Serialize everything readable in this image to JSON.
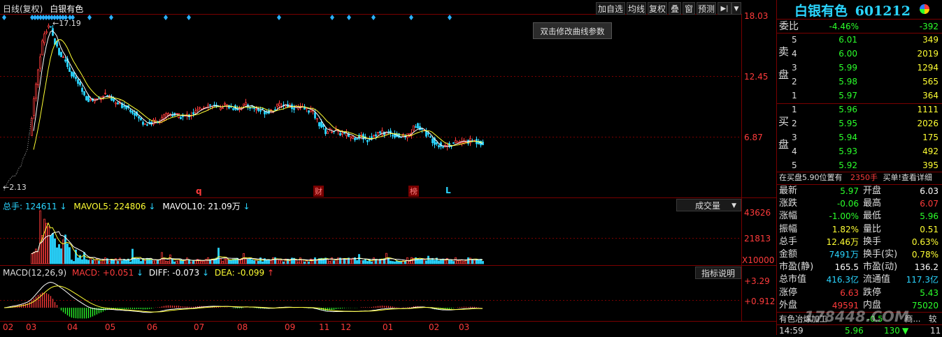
{
  "main_header": {
    "period": "日线(复权)",
    "name": "白银有色"
  },
  "toolbar": [
    "加自选",
    "均线",
    "复权",
    "叠",
    "窗",
    "预测"
  ],
  "toolbar_arrows": {
    "play": "▶|",
    "menu": "▼"
  },
  "tooltip": "双击修改曲线参数",
  "price_axis": {
    "top": "18.03",
    "mid": "12.45",
    "low": "6.87"
  },
  "price_marks": {
    "high": "17.19",
    "low": "2.13"
  },
  "event_labels": [
    {
      "text": "q",
      "boxed": false
    },
    {
      "text": "财",
      "boxed": true
    },
    {
      "text": "榜",
      "boxed": true
    },
    {
      "text": "L",
      "boxed": false
    }
  ],
  "volume_header": {
    "total": "总手: 124611",
    "mavol5": "MAVOL5: 224806",
    "mavol10": "MAVOL10: 21.09万",
    "dropdown": "成交量"
  },
  "volume_axis": {
    "top": "43626",
    "mid": "21813",
    "unit": "X10000"
  },
  "macd_header": {
    "title": "MACD(12,26,9)",
    "macd": "MACD: +0.051",
    "diff": "DIFF: -0.073",
    "dea": "DEA: -0.099",
    "help": "指标说明"
  },
  "macd_axis": {
    "top": "+3.29",
    "mid": "+0.912"
  },
  "x_axis": [
    "02",
    "03",
    "04",
    "05",
    "06",
    "07",
    "08",
    "09",
    "11",
    "12",
    "01",
    "02",
    "03"
  ],
  "quote": {
    "name": "白银有色",
    "code": "601212",
    "weibi_label": "委比",
    "weibi_pct": "-4.46%",
    "weibi_val": "-392",
    "sell_label": [
      "卖",
      "盘"
    ],
    "sell": [
      {
        "lvl": "5",
        "price": "6.01",
        "vol": "349"
      },
      {
        "lvl": "4",
        "price": "6.00",
        "vol": "2019"
      },
      {
        "lvl": "3",
        "price": "5.99",
        "vol": "1294"
      },
      {
        "lvl": "2",
        "price": "5.98",
        "vol": "565"
      },
      {
        "lvl": "1",
        "price": "5.97",
        "vol": "364"
      }
    ],
    "buy_label": [
      "买",
      "盘"
    ],
    "buy": [
      {
        "lvl": "1",
        "price": "5.96",
        "vol": "1111"
      },
      {
        "lvl": "2",
        "price": "5.95",
        "vol": "2026"
      },
      {
        "lvl": "3",
        "price": "5.94",
        "vol": "175"
      },
      {
        "lvl": "4",
        "price": "5.93",
        "vol": "492"
      },
      {
        "lvl": "5",
        "price": "5.92",
        "vol": "395"
      }
    ],
    "notice": {
      "a": "在买盘5.90位置有",
      "b": "2350手",
      "c": "买单!查看详细"
    },
    "stats": [
      {
        "l1": "最新",
        "v1": "5.97",
        "c1": "green",
        "l2": "开盘",
        "v2": "6.03",
        "c2": "white"
      },
      {
        "l1": "涨跌",
        "v1": "-0.06",
        "c1": "green",
        "l2": "最高",
        "v2": "6.07",
        "c2": "red"
      },
      {
        "l1": "涨幅",
        "v1": "-1.00%",
        "c1": "green",
        "l2": "最低",
        "v2": "5.96",
        "c2": "green"
      },
      {
        "l1": "振幅",
        "v1": "1.82%",
        "c1": "yellow",
        "l2": "量比",
        "v2": "0.51",
        "c2": "yellow"
      },
      {
        "l1": "总手",
        "v1": "12.46万",
        "c1": "yellow",
        "l2": "换手",
        "v2": "0.63%",
        "c2": "yellow"
      },
      {
        "l1": "金额",
        "v1": "7491万",
        "c1": "cyan",
        "l2": "换手(实)",
        "v2": "0.78%",
        "c2": "yellow"
      },
      {
        "l1": "市盈(静)",
        "v1": "165.5",
        "c1": "white",
        "l2": "市盈(动)",
        "v2": "136.2",
        "c2": "white"
      },
      {
        "l1": "总市值",
        "v1": "416.3亿",
        "c1": "cyan",
        "l2": "流通值",
        "v2": "117.3亿",
        "c2": "cyan"
      },
      {
        "l1": "涨停",
        "v1": "6.63",
        "c1": "red",
        "l2": "跌停",
        "v2": "5.43",
        "c2": "green"
      },
      {
        "l1": "外盘",
        "v1": "49591",
        "c1": "red",
        "l2": "内盘",
        "v2": "75020",
        "c2": "green"
      }
    ],
    "industry": {
      "name": "有色冶炼加工",
      "pct": "-0.5",
      "extra": "商...",
      "rank": "较"
    },
    "tick": {
      "time": "14:59",
      "price": "5.96",
      "vol": "130",
      "arrow": "▼",
      "num": "11"
    }
  },
  "watermark": "178448.COM",
  "colors": {
    "up": "#ff3b3b",
    "down": "#2ad5ff",
    "ma": "#ffffff",
    "grid": "#7a0000",
    "accent": "#2ad5ff"
  },
  "chart_data": {
    "type": "line",
    "title": "白银有色 日线(复权)",
    "price_ylim": [
      2.13,
      18.03
    ],
    "close_approx": [
      {
        "month": "02",
        "value": 2.13
      },
      {
        "month": "03",
        "value": 17.19
      },
      {
        "month": "04",
        "value": 13.5
      },
      {
        "month": "05",
        "value": 10.2
      },
      {
        "month": "06",
        "value": 8.8
      },
      {
        "month": "07",
        "value": 10.0
      },
      {
        "month": "08",
        "value": 9.8
      },
      {
        "month": "09",
        "value": 9.6
      },
      {
        "month": "11",
        "value": 7.2
      },
      {
        "month": "12",
        "value": 6.8
      },
      {
        "month": "01",
        "value": 7.4
      },
      {
        "month": "02",
        "value": 6.7
      },
      {
        "month": "03",
        "value": 6.2
      }
    ],
    "volume_ylim": [
      0,
      43626
    ],
    "macd_ylim": [
      -0.9,
      3.29
    ]
  }
}
